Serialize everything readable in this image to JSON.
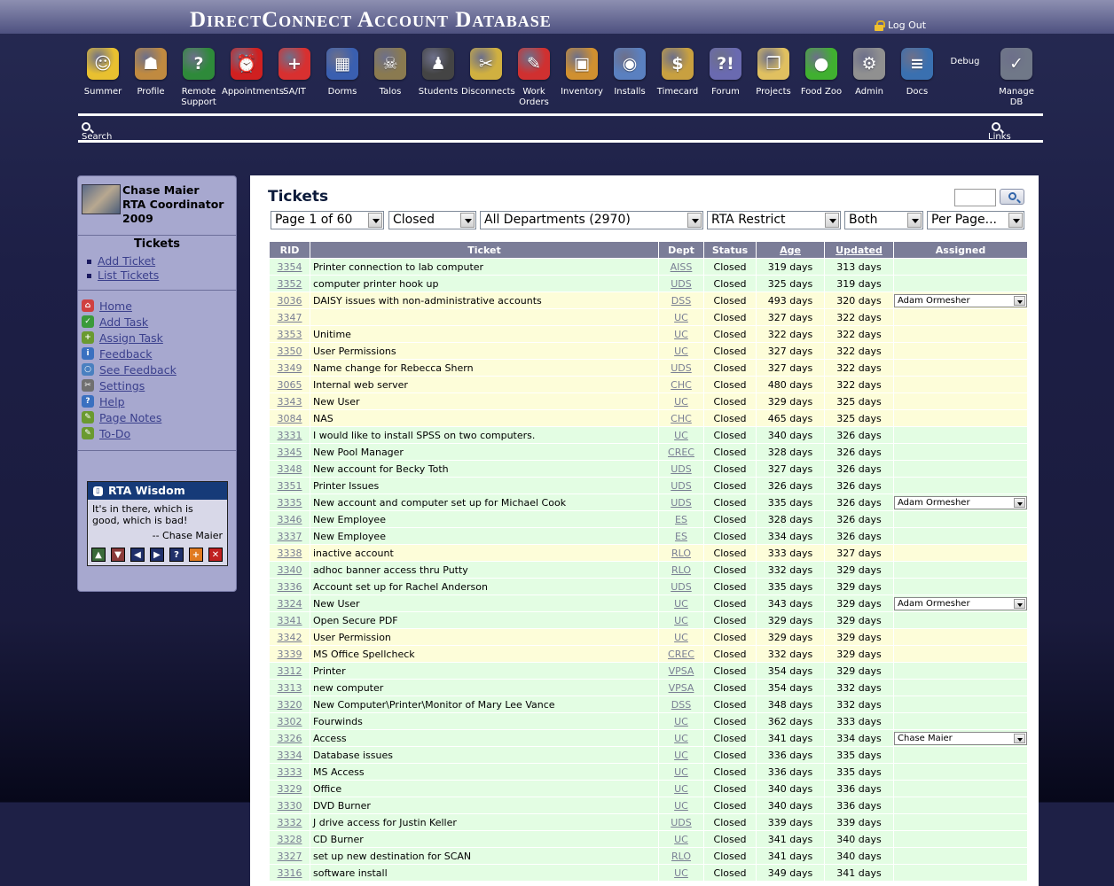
{
  "app": {
    "title": "DirectConnect Account Database",
    "logout_label": "Log Out"
  },
  "nav": [
    {
      "label": "Summer",
      "icon": "sun-face-icon",
      "color": "#e8c030",
      "glyph": "☺"
    },
    {
      "label": "Profile",
      "icon": "profile-icon",
      "color": "#c08a40",
      "glyph": "☗"
    },
    {
      "label": "Remote Support",
      "icon": "globe-question-icon",
      "color": "#2e8a3a",
      "glyph": "?"
    },
    {
      "label": "Appointments",
      "icon": "alarm-clock-icon",
      "color": "#d02020",
      "glyph": "⏰"
    },
    {
      "label": "SA/IT",
      "icon": "lifebuoy-icon",
      "color": "#d83030",
      "glyph": "+"
    },
    {
      "label": "Dorms",
      "icon": "building-icon",
      "color": "#3a5fb0",
      "glyph": "▦"
    },
    {
      "label": "Talos",
      "icon": "skull-icon",
      "color": "#8a7a50",
      "glyph": "☠"
    },
    {
      "label": "Students",
      "icon": "person-icon",
      "color": "#444444",
      "glyph": "♟"
    },
    {
      "label": "Disconnects",
      "icon": "disconnect-plug-icon",
      "color": "#d0b040",
      "glyph": "✂"
    },
    {
      "label": "Work Orders",
      "icon": "notepad-pin-icon",
      "color": "#d03030",
      "glyph": "✎"
    },
    {
      "label": "Inventory",
      "icon": "box-icon",
      "color": "#d09030",
      "glyph": "▣"
    },
    {
      "label": "Installs",
      "icon": "install-disk-icon",
      "color": "#5a80c0",
      "glyph": "◉"
    },
    {
      "label": "Timecard",
      "icon": "money-bag-icon",
      "color": "#c8a040",
      "glyph": "$"
    },
    {
      "label": "Forum",
      "icon": "speech-bubbles-icon",
      "color": "#6a6ab0",
      "glyph": "?!"
    },
    {
      "label": "Projects",
      "icon": "folders-icon",
      "color": "#e0c060",
      "glyph": "❐"
    },
    {
      "label": "Food Zoo",
      "icon": "apple-icon",
      "color": "#40b030",
      "glyph": "●"
    },
    {
      "label": "Admin",
      "icon": "gears-icon",
      "color": "#909090",
      "glyph": "⚙"
    },
    {
      "label": "Docs",
      "icon": "books-icon",
      "color": "#3a70b0",
      "glyph": "≡"
    },
    {
      "label": "Debug",
      "icon": "",
      "color": "",
      "glyph": ""
    },
    {
      "label": "Manage DB",
      "icon": "database-check-icon",
      "color": "#707888",
      "glyph": "✓"
    }
  ],
  "subnav": {
    "search_label": "Search",
    "links_label": "Links"
  },
  "sidebar": {
    "user_name": "Chase Maier",
    "user_role": "RTA Coordinator",
    "user_year": "2009",
    "tickets_heading": "Tickets",
    "ticket_links": [
      "Add Ticket",
      "List Tickets"
    ],
    "links": [
      {
        "label": "Home",
        "icon": "home-icon",
        "color": "#d04040",
        "glyph": "⌂"
      },
      {
        "label": "Add Task",
        "icon": "checkbox-icon",
        "color": "#3a9a3a",
        "glyph": "✓"
      },
      {
        "label": "Assign Task",
        "icon": "assign-user-icon",
        "color": "#6a9a30",
        "glyph": "+"
      },
      {
        "label": "Feedback",
        "icon": "info-icon",
        "color": "#3a70c0",
        "glyph": "i"
      },
      {
        "label": "See Feedback",
        "icon": "magnifier-icon",
        "color": "#4a80c0",
        "glyph": "○"
      },
      {
        "label": "Settings",
        "icon": "tools-icon",
        "color": "#707070",
        "glyph": "✂"
      },
      {
        "label": "Help",
        "icon": "help-icon",
        "color": "#3a70c0",
        "glyph": "?"
      },
      {
        "label": "Page Notes",
        "icon": "note-pencil-icon",
        "color": "#6a9a30",
        "glyph": "✎"
      },
      {
        "label": "To-Do",
        "icon": "todo-pencil-icon",
        "color": "#6a9a30",
        "glyph": "✎"
      }
    ],
    "wisdom": {
      "title": "RTA Wisdom",
      "quote": "It's in there, which is good, which is bad!",
      "author": "-- Chase Maier"
    }
  },
  "main": {
    "title": "Tickets",
    "filters": {
      "page": "Page 1 of 60",
      "status": "Closed",
      "department": "All Departments (2970)",
      "restrict": "RTA Restrict",
      "scope": "Both",
      "per_page": "Per Page..."
    },
    "columns": [
      "RID",
      "Ticket",
      "Dept",
      "Status",
      "Age",
      "Updated",
      "Assigned"
    ],
    "rows": [
      {
        "rid": "3354",
        "ticket": "Printer connection to lab computer",
        "dept": "AISS",
        "status": "Closed",
        "age": "319 days",
        "updated": "313 days",
        "assigned": "",
        "tone": "g"
      },
      {
        "rid": "3352",
        "ticket": "computer printer hook up",
        "dept": "UDS",
        "status": "Closed",
        "age": "325 days",
        "updated": "319 days",
        "assigned": "",
        "tone": "g"
      },
      {
        "rid": "3036",
        "ticket": "DAISY issues with non-administrative accounts",
        "dept": "DSS",
        "status": "Closed",
        "age": "493 days",
        "updated": "320 days",
        "assigned": "Adam Ormesher",
        "tone": "y"
      },
      {
        "rid": "3347",
        "ticket": "",
        "dept": "UC",
        "status": "Closed",
        "age": "327 days",
        "updated": "322 days",
        "assigned": "",
        "tone": "y"
      },
      {
        "rid": "3353",
        "ticket": "Unitime",
        "dept": "UC",
        "status": "Closed",
        "age": "322 days",
        "updated": "322 days",
        "assigned": "",
        "tone": "y"
      },
      {
        "rid": "3350",
        "ticket": "User Permissions",
        "dept": "UC",
        "status": "Closed",
        "age": "327 days",
        "updated": "322 days",
        "assigned": "",
        "tone": "y"
      },
      {
        "rid": "3349",
        "ticket": "Name change for Rebecca Shern",
        "dept": "UDS",
        "status": "Closed",
        "age": "327 days",
        "updated": "322 days",
        "assigned": "",
        "tone": "y"
      },
      {
        "rid": "3065",
        "ticket": "Internal web server",
        "dept": "CHC",
        "status": "Closed",
        "age": "480 days",
        "updated": "322 days",
        "assigned": "",
        "tone": "y"
      },
      {
        "rid": "3343",
        "ticket": "New User",
        "dept": "UC",
        "status": "Closed",
        "age": "329 days",
        "updated": "325 days",
        "assigned": "",
        "tone": "y"
      },
      {
        "rid": "3084",
        "ticket": "NAS",
        "dept": "CHC",
        "status": "Closed",
        "age": "465 days",
        "updated": "325 days",
        "assigned": "",
        "tone": "y"
      },
      {
        "rid": "3331",
        "ticket": "I would like to install SPSS on two computers.",
        "dept": "UC",
        "status": "Closed",
        "age": "340 days",
        "updated": "326 days",
        "assigned": "",
        "tone": "g"
      },
      {
        "rid": "3345",
        "ticket": "New Pool Manager",
        "dept": "CREC",
        "status": "Closed",
        "age": "328 days",
        "updated": "326 days",
        "assigned": "",
        "tone": "g"
      },
      {
        "rid": "3348",
        "ticket": "New account for Becky Toth",
        "dept": "UDS",
        "status": "Closed",
        "age": "327 days",
        "updated": "326 days",
        "assigned": "",
        "tone": "g"
      },
      {
        "rid": "3351",
        "ticket": "Printer Issues",
        "dept": "UDS",
        "status": "Closed",
        "age": "326 days",
        "updated": "326 days",
        "assigned": "",
        "tone": "g"
      },
      {
        "rid": "3335",
        "ticket": "New account and computer set up for Michael Cook",
        "dept": "UDS",
        "status": "Closed",
        "age": "335 days",
        "updated": "326 days",
        "assigned": "Adam Ormesher",
        "tone": "g"
      },
      {
        "rid": "3346",
        "ticket": "New Employee",
        "dept": "ES",
        "status": "Closed",
        "age": "328 days",
        "updated": "326 days",
        "assigned": "",
        "tone": "g"
      },
      {
        "rid": "3337",
        "ticket": "New Employee",
        "dept": "ES",
        "status": "Closed",
        "age": "334 days",
        "updated": "326 days",
        "assigned": "",
        "tone": "g"
      },
      {
        "rid": "3338",
        "ticket": "inactive account",
        "dept": "RLO",
        "status": "Closed",
        "age": "333 days",
        "updated": "327 days",
        "assigned": "",
        "tone": "y"
      },
      {
        "rid": "3340",
        "ticket": "adhoc banner access thru Putty",
        "dept": "RLO",
        "status": "Closed",
        "age": "332 days",
        "updated": "329 days",
        "assigned": "",
        "tone": "g"
      },
      {
        "rid": "3336",
        "ticket": "Account set up for Rachel Anderson",
        "dept": "UDS",
        "status": "Closed",
        "age": "335 days",
        "updated": "329 days",
        "assigned": "",
        "tone": "g"
      },
      {
        "rid": "3324",
        "ticket": "New User",
        "dept": "UC",
        "status": "Closed",
        "age": "343 days",
        "updated": "329 days",
        "assigned": "Adam Ormesher",
        "tone": "g"
      },
      {
        "rid": "3341",
        "ticket": "Open Secure PDF",
        "dept": "UC",
        "status": "Closed",
        "age": "329 days",
        "updated": "329 days",
        "assigned": "",
        "tone": "g"
      },
      {
        "rid": "3342",
        "ticket": "User Permission",
        "dept": "UC",
        "status": "Closed",
        "age": "329 days",
        "updated": "329 days",
        "assigned": "",
        "tone": "y"
      },
      {
        "rid": "3339",
        "ticket": "MS Office Spellcheck",
        "dept": "CREC",
        "status": "Closed",
        "age": "332 days",
        "updated": "329 days",
        "assigned": "",
        "tone": "y"
      },
      {
        "rid": "3312",
        "ticket": "Printer",
        "dept": "VPSA",
        "status": "Closed",
        "age": "354 days",
        "updated": "329 days",
        "assigned": "",
        "tone": "g"
      },
      {
        "rid": "3313",
        "ticket": "new computer",
        "dept": "VPSA",
        "status": "Closed",
        "age": "354 days",
        "updated": "332 days",
        "assigned": "",
        "tone": "g"
      },
      {
        "rid": "3320",
        "ticket": "New Computer\\Printer\\Monitor of Mary Lee Vance",
        "dept": "DSS",
        "status": "Closed",
        "age": "348 days",
        "updated": "332 days",
        "assigned": "",
        "tone": "g"
      },
      {
        "rid": "3302",
        "ticket": "Fourwinds",
        "dept": "UC",
        "status": "Closed",
        "age": "362 days",
        "updated": "333 days",
        "assigned": "",
        "tone": "g"
      },
      {
        "rid": "3326",
        "ticket": "Access",
        "dept": "UC",
        "status": "Closed",
        "age": "341 days",
        "updated": "334 days",
        "assigned": "Chase Maier",
        "tone": "g"
      },
      {
        "rid": "3334",
        "ticket": "Database issues",
        "dept": "UC",
        "status": "Closed",
        "age": "336 days",
        "updated": "335 days",
        "assigned": "",
        "tone": "g"
      },
      {
        "rid": "3333",
        "ticket": "MS Access",
        "dept": "UC",
        "status": "Closed",
        "age": "336 days",
        "updated": "335 days",
        "assigned": "",
        "tone": "g"
      },
      {
        "rid": "3329",
        "ticket": "Office",
        "dept": "UC",
        "status": "Closed",
        "age": "340 days",
        "updated": "336 days",
        "assigned": "",
        "tone": "g"
      },
      {
        "rid": "3330",
        "ticket": "DVD Burner",
        "dept": "UC",
        "status": "Closed",
        "age": "340 days",
        "updated": "336 days",
        "assigned": "",
        "tone": "g"
      },
      {
        "rid": "3332",
        "ticket": "J drive access for Justin Keller",
        "dept": "UDS",
        "status": "Closed",
        "age": "339 days",
        "updated": "339 days",
        "assigned": "",
        "tone": "g"
      },
      {
        "rid": "3328",
        "ticket": "CD Burner",
        "dept": "UC",
        "status": "Closed",
        "age": "341 days",
        "updated": "340 days",
        "assigned": "",
        "tone": "g"
      },
      {
        "rid": "3327",
        "ticket": "set up new destination for SCAN",
        "dept": "RLO",
        "status": "Closed",
        "age": "341 days",
        "updated": "340 days",
        "assigned": "",
        "tone": "g"
      },
      {
        "rid": "3316",
        "ticket": "software install",
        "dept": "UC",
        "status": "Closed",
        "age": "349 days",
        "updated": "341 days",
        "assigned": "",
        "tone": "g"
      }
    ]
  }
}
